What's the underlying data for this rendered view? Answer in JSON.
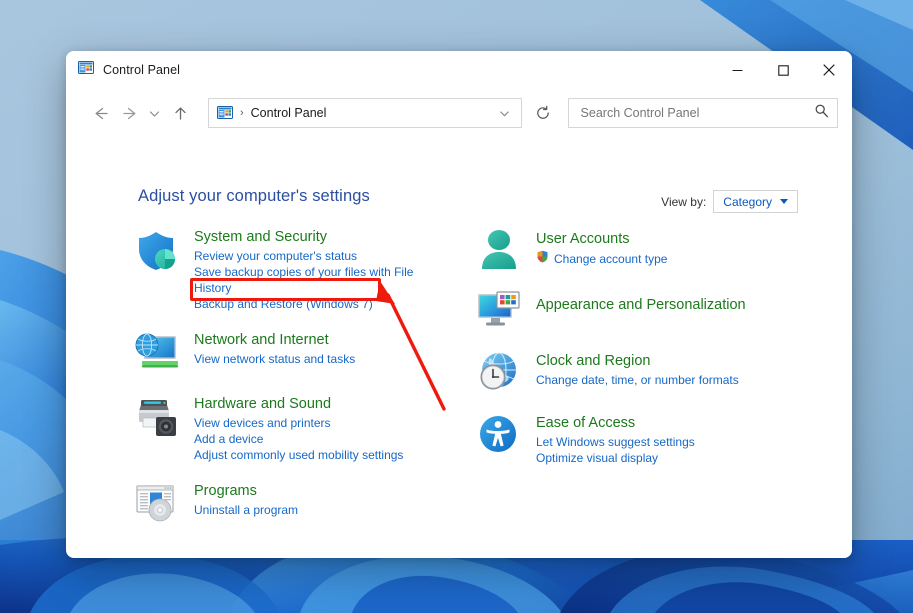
{
  "window": {
    "title": "Control Panel",
    "app_icon": "control-panel-icon",
    "minimize_label": "Minimize",
    "maximize_label": "Maximize",
    "close_label": "Close"
  },
  "nav": {
    "back_label": "Back",
    "forward_label": "Forward",
    "recent_label": "Recent locations",
    "up_label": "Up",
    "refresh_label": "Refresh",
    "address": {
      "icon": "control-panel-icon",
      "separator": "›",
      "crumb": "Control Panel",
      "dropdown": "⌄"
    }
  },
  "search": {
    "placeholder": "Search Control Panel",
    "value": "",
    "icon": "search-icon"
  },
  "main": {
    "heading": "Adjust your computer's settings",
    "view_by": {
      "label": "View by:",
      "value": "Category",
      "caret": "caret-down-icon"
    }
  },
  "categories": {
    "left": [
      {
        "icon": "shield-security-icon",
        "title": "System and Security",
        "links": [
          {
            "text": "Review your computer's status",
            "highlight": false,
            "shield": false
          },
          {
            "text": "Save backup copies of your files with File History",
            "highlight": false,
            "shield": false
          },
          {
            "text": "Backup and Restore (Windows 7)",
            "highlight": true,
            "shield": false
          }
        ]
      },
      {
        "icon": "network-globe-monitor-icon",
        "title": "Network and Internet",
        "links": [
          {
            "text": "View network status and tasks",
            "highlight": false,
            "shield": false
          }
        ]
      },
      {
        "icon": "printer-speaker-icon",
        "title": "Hardware and Sound",
        "links": [
          {
            "text": "View devices and printers",
            "highlight": false,
            "shield": false
          },
          {
            "text": "Add a device",
            "highlight": false,
            "shield": false
          },
          {
            "text": "Adjust commonly used mobility settings",
            "highlight": false,
            "shield": false
          }
        ]
      },
      {
        "icon": "programs-disc-icon",
        "title": "Programs",
        "links": [
          {
            "text": "Uninstall a program",
            "highlight": false,
            "shield": false
          }
        ]
      }
    ],
    "right": [
      {
        "icon": "user-account-icon",
        "title": "User Accounts",
        "links": [
          {
            "text": "Change account type",
            "highlight": false,
            "shield": true
          }
        ]
      },
      {
        "icon": "appearance-monitor-icon",
        "title": "Appearance and Personalization",
        "links": []
      },
      {
        "icon": "clock-globe-icon",
        "title": "Clock and Region",
        "links": [
          {
            "text": "Change date, time, or number formats",
            "highlight": false,
            "shield": false
          }
        ]
      },
      {
        "icon": "ease-of-access-icon",
        "title": "Ease of Access",
        "links": [
          {
            "text": "Let Windows suggest settings",
            "highlight": false,
            "shield": false
          },
          {
            "text": "Optimize visual display",
            "highlight": false,
            "shield": false
          }
        ]
      }
    ]
  },
  "annotation": {
    "highlight_target": "Backup and Restore (Windows 7)",
    "arrow": "red-callout-arrow",
    "color": "#ef1a0e"
  },
  "colors": {
    "category_title": "#1c7a1c",
    "link": "#1668c8",
    "heading": "#2b4fa0",
    "annotation_red": "#ef1a0e",
    "desktop": "#a3c2dc"
  }
}
